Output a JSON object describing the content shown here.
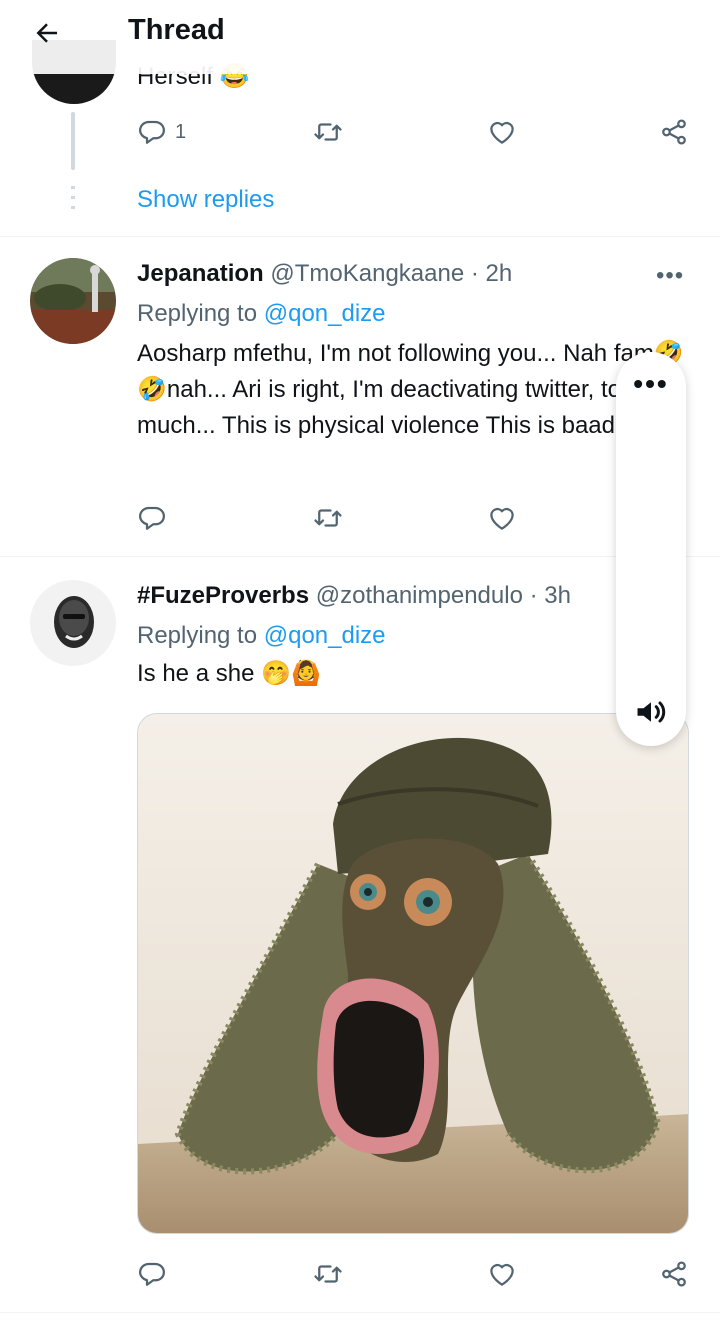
{
  "header": {
    "title": "Thread",
    "back_icon": "arrow-left-icon"
  },
  "previous_tweet": {
    "text_partial": "Herself 😂",
    "actions": {
      "reply_count": "1"
    },
    "show_replies_label": "Show replies"
  },
  "tweets": [
    {
      "name": "Jepanation",
      "handle": "@TmoKangkaane",
      "time": "· 2h",
      "replying_prefix": "Replying to ",
      "replying_to": "@qon_dize",
      "text": "Aosharp mfethu, I'm not following you... Nah fam🤣🤣nah... Ari is right, I'm deactivating twitter, too much... This is physical violence This is baad guys..",
      "more_label": "•••"
    },
    {
      "name": "#FuzeProverbs",
      "handle": "@zothanimpendulo",
      "time": "· 3h",
      "replying_prefix": "Replying to ",
      "replying_to": "@qon_dize",
      "text": "Is he a she 🤭🙆",
      "more_label": "•••"
    }
  ],
  "floating_panel": {
    "more_label": "•••",
    "volume_icon": "volume-icon"
  },
  "icons": [
    "reply-icon",
    "retweet-icon",
    "like-icon",
    "share-icon"
  ],
  "colors": {
    "accent": "#1d9bf0",
    "secondary_text": "#536471",
    "primary_text": "#0f1419"
  }
}
